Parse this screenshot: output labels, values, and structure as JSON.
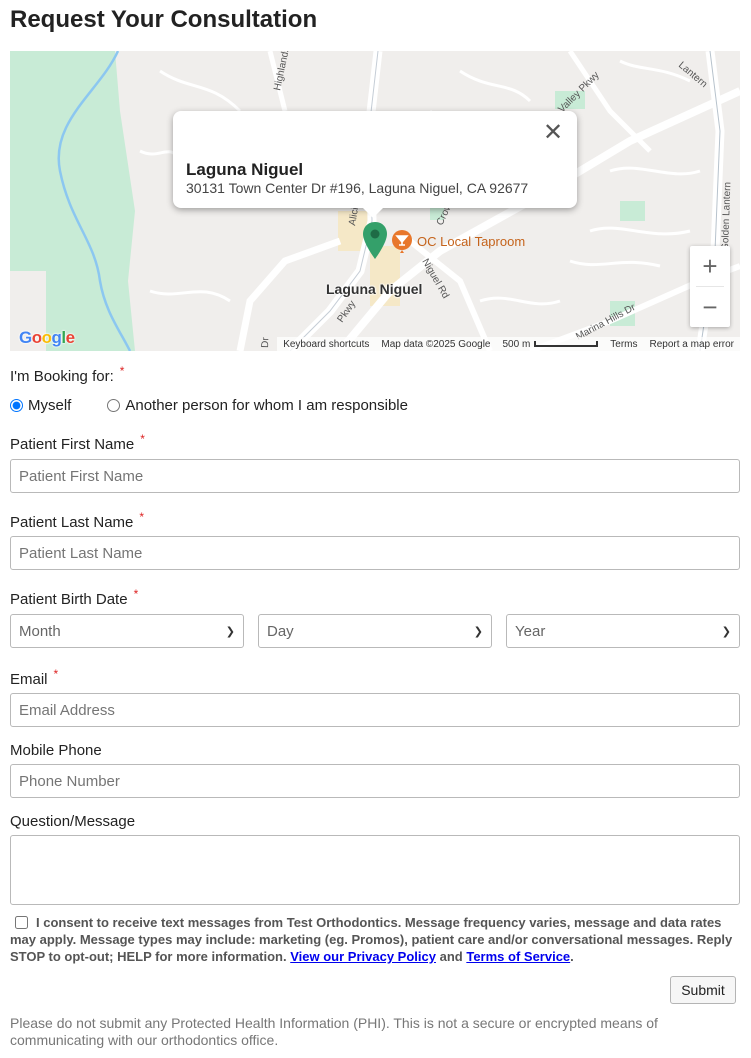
{
  "page_title": "Request Your Consultation",
  "map": {
    "popup": {
      "title": "Laguna Niguel",
      "address": "30131 Town Center Dr #196, Laguna Niguel, CA 92677",
      "close_glyph": "✕"
    },
    "poi_label": "OC Local Taproom",
    "area_label": "Laguna Niguel",
    "street_labels": [
      "Highlands Ave",
      "Alicia",
      "Crown",
      "Niguel Rd",
      "Pkwy",
      "Valley Pkwy",
      "Lantern",
      "Golden Lantern",
      "Marina Hills Dr",
      "Dr"
    ],
    "zoom_in": "+",
    "zoom_out": "−",
    "google_logo": [
      "G",
      "o",
      "o",
      "g",
      "l",
      "e"
    ],
    "attribution": {
      "shortcuts": "Keyboard shortcuts",
      "map_data": "Map data ©2025 Google",
      "scale": "500 m",
      "terms": "Terms",
      "report": "Report a map error"
    },
    "colors": {
      "water": "#aadaff",
      "park": "#c8ebd6",
      "pin": "#34a06a",
      "poi": "#e8772b"
    }
  },
  "form": {
    "booking_label": "I'm Booking for:",
    "required_mark": "*",
    "booking_options": [
      "Myself",
      "Another person for whom I am responsible"
    ],
    "first_name": {
      "label": "Patient First Name",
      "placeholder": "Patient First Name"
    },
    "last_name": {
      "label": "Patient Last Name",
      "placeholder": "Patient Last Name"
    },
    "birth_date": {
      "label": "Patient Birth Date",
      "month": "Month",
      "day": "Day",
      "year": "Year"
    },
    "email": {
      "label": "Email",
      "placeholder": "Email Address"
    },
    "phone": {
      "label": "Mobile Phone",
      "placeholder": "Phone Number"
    },
    "message": {
      "label": "Question/Message"
    },
    "consent_text": "I consent to receive text messages from Test Orthodontics. Message frequency varies, message and data rates may apply. Message types may include: marketing (eg. Promos), patient care and/or conversational messages. Reply STOP to opt-out; HELP for more information.",
    "privacy_link": "View our Privacy Policy",
    "and_text": "and",
    "terms_link": "Terms of Service",
    "period": ".",
    "submit_label": "Submit",
    "disclaimer": "Please do not submit any Protected Health Information (PHI). This is not a secure or encrypted means of communicating with our orthodontics office."
  }
}
